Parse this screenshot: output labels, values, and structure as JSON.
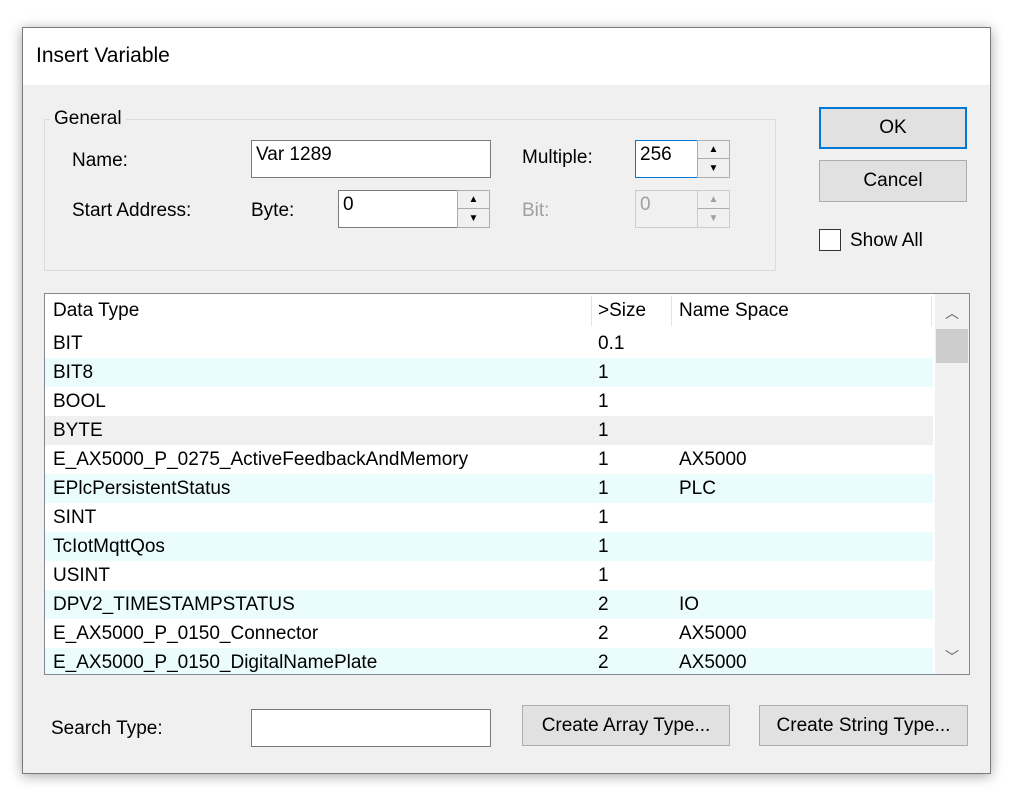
{
  "window": {
    "title": "Insert Variable"
  },
  "general": {
    "legend": "General",
    "name_label": "Name:",
    "name_value": "Var 1289",
    "multiple_label": "Multiple:",
    "multiple_value": "256",
    "start_address_label": "Start Address:",
    "byte_label": "Byte:",
    "byte_value": "0",
    "bit_label": "Bit:",
    "bit_value": "0"
  },
  "buttons": {
    "ok": "OK",
    "cancel": "Cancel",
    "create_array": "Create Array Type...",
    "create_string": "Create String Type..."
  },
  "show_all": {
    "label": "Show All",
    "checked": false
  },
  "table": {
    "columns": [
      "Data Type",
      ">Size",
      "Name Space"
    ],
    "rows": [
      {
        "type": "BIT",
        "size": "0.1",
        "ns": ""
      },
      {
        "type": "BIT8",
        "size": "1",
        "ns": ""
      },
      {
        "type": "BOOL",
        "size": "1",
        "ns": ""
      },
      {
        "type": "BYTE",
        "size": "1",
        "ns": ""
      },
      {
        "type": "E_AX5000_P_0275_ActiveFeedbackAndMemory",
        "size": "1",
        "ns": "AX5000"
      },
      {
        "type": "EPlcPersistentStatus",
        "size": "1",
        "ns": "PLC"
      },
      {
        "type": "SINT",
        "size": "1",
        "ns": ""
      },
      {
        "type": "TcIotMqttQos",
        "size": "1",
        "ns": ""
      },
      {
        "type": "USINT",
        "size": "1",
        "ns": ""
      },
      {
        "type": "DPV2_TIMESTAMPSTATUS",
        "size": "2",
        "ns": "IO"
      },
      {
        "type": "E_AX5000_P_0150_Connector",
        "size": "2",
        "ns": "AX5000"
      },
      {
        "type": "E_AX5000_P_0150_DigitalNamePlate",
        "size": "2",
        "ns": "AX5000"
      }
    ],
    "row_backgrounds": [
      "#ffffff",
      "#eafcfc",
      "#ffffff",
      "#f0f0f0",
      "#ffffff",
      "#eafcfc",
      "#ffffff",
      "#eafcfc",
      "#ffffff",
      "#eafcfc",
      "#ffffff",
      "#eafcfc"
    ]
  },
  "search": {
    "label": "Search Type:",
    "value": ""
  },
  "icons": {
    "spin_up": "chevron-up-icon",
    "spin_down": "chevron-down-icon",
    "scroll_up": "chevron-up-icon",
    "scroll_down": "chevron-down-icon"
  },
  "colors": {
    "accent": "#0078d7",
    "row_alt": "#eafcfc",
    "selected_row": "#f0f0f0"
  }
}
